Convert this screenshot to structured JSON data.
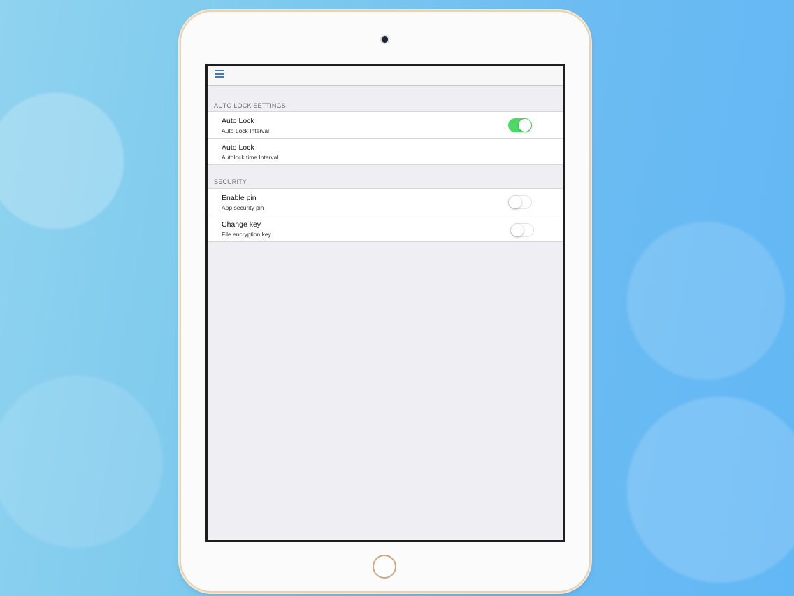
{
  "nav": {
    "menu_icon": "hamburger-menu-icon"
  },
  "sections": [
    {
      "header": "AUTO LOCK SETTINGS",
      "items": [
        {
          "title": "Auto Lock",
          "subtitle": "Auto Lock Interval",
          "toggle": true
        },
        {
          "title": "Auto Lock",
          "subtitle": "Autolock time Interval"
        }
      ]
    },
    {
      "header": "SECURITY",
      "items": [
        {
          "title": "Enable pin",
          "subtitle": "App security pin",
          "toggle": false
        },
        {
          "title": "Change key",
          "subtitle": "File encryption key",
          "toggle": false
        }
      ]
    }
  ],
  "colors": {
    "accent": "#3b7ac4",
    "toggle_on": "#4cd964"
  }
}
